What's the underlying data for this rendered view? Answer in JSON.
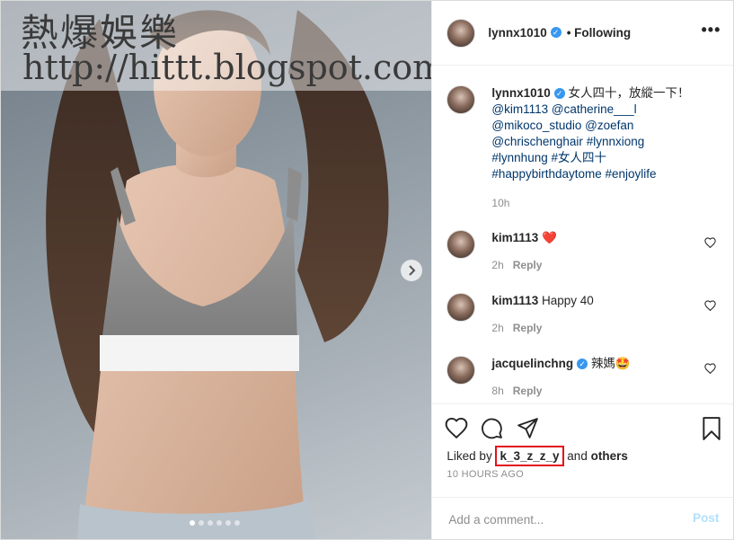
{
  "watermark": {
    "line1": "熱爆娛樂",
    "line2": "http://hittt.blogspot.com"
  },
  "media": {
    "slides_total": 6,
    "active_slide": 1
  },
  "header": {
    "username": "lynnx1010",
    "verified": "✓",
    "follow_status": "• Following",
    "more": "•••"
  },
  "caption": {
    "username": "lynnx1010",
    "text": "女人四十，放縱一下！",
    "mentions": [
      "@kim1113",
      "@catherine___l",
      "@mikoco_studio",
      "@zoefan",
      "@chrischenghair",
      "#lynnxiong",
      "#lynnhung",
      "#女人四十",
      "#happybirthdaytome",
      "#enjoylife"
    ],
    "time": "10h"
  },
  "comments": [
    {
      "username": "kim1113",
      "text": "❤️",
      "time": "2h",
      "reply": "Reply"
    },
    {
      "username": "kim1113",
      "text": "Happy 40",
      "time": "2h",
      "reply": "Reply"
    },
    {
      "username": "jacquelinchng",
      "text": "辣媽🤩",
      "time": "8h",
      "reply": "Reply"
    }
  ],
  "likes": {
    "prefix": "Liked by",
    "user": "k_3_z_z_y",
    "mid": "and",
    "suffix": "others"
  },
  "timestamp": "10 HOURS AGO",
  "add_comment": {
    "placeholder": "Add a comment...",
    "post_label": "Post"
  },
  "colors": {
    "link": "#00376b",
    "verified": "#3897f0",
    "highlight_box": "#e2111a",
    "post_disabled": "#b2dffc"
  }
}
